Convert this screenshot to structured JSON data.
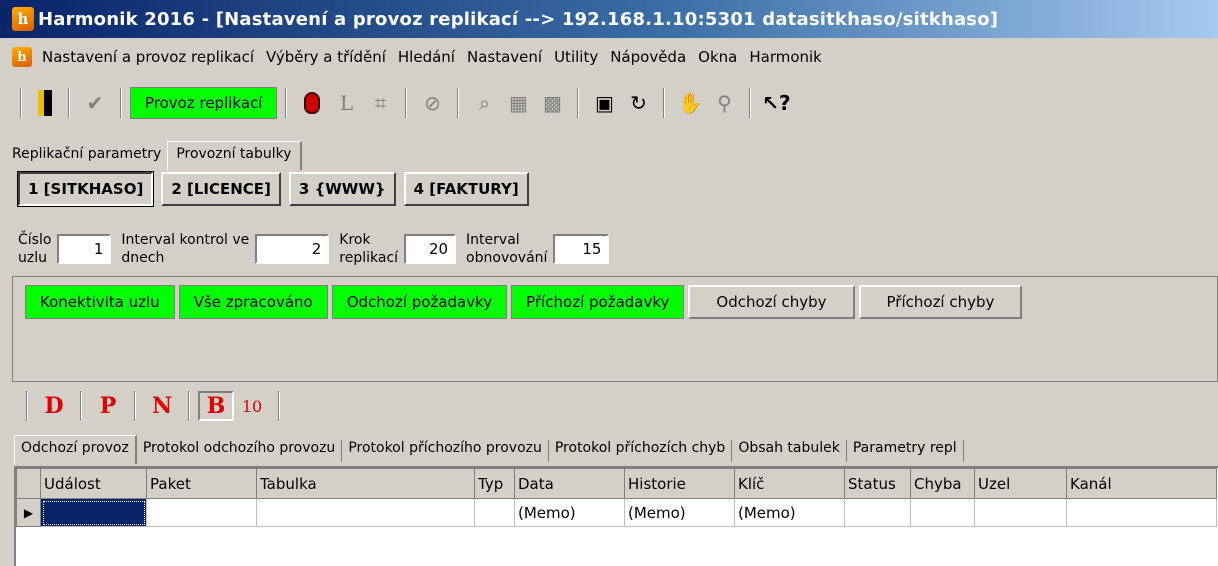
{
  "window": {
    "title": "Harmonik 2016 - [Nastavení a provoz replikací --> 192.168.1.10:5301 datasitkhaso/sitkhaso]",
    "icon": "harmonik-app-icon"
  },
  "menu": {
    "items": [
      "Nastavení a provoz replikací",
      "Výběry a třídění",
      "Hledání",
      "Nastavení",
      "Utility",
      "Nápověda",
      "Okna",
      "Harmonik"
    ]
  },
  "toolbar": {
    "mode_label": "Provoz replikací",
    "icons": [
      "exit-door-icon",
      "checkmark-icon",
      "mouse-icon",
      "l-icon",
      "pin-icon",
      "cancel-circle-icon",
      "magnifier-icon",
      "find-table-icon",
      "find-all-icon",
      "grid-icon",
      "refresh-icon",
      "hand-icon",
      "flashlight-icon",
      "help-pointer-icon"
    ],
    "accent": "#00ff00"
  },
  "param_tabs": [
    {
      "label": "Replikační parametry",
      "active": false
    },
    {
      "label": "Provozní tabulky",
      "active": true
    }
  ],
  "nodes": [
    {
      "label": "1 [SITKHASO]",
      "active": true
    },
    {
      "label": "2 [LICENCE]",
      "active": false
    },
    {
      "label": "3 {WWW}",
      "active": false
    },
    {
      "label": "4 [FAKTURY]",
      "active": false
    }
  ],
  "fields": {
    "node_number": {
      "label_line1": "Číslo",
      "label_line2": "uzlu",
      "value": "1"
    },
    "interval_days": {
      "label_line1": "Interval kontrol ve",
      "label_line2": "dnech",
      "value": "2"
    },
    "step": {
      "label_line1": "Krok",
      "label_line2": "replikací",
      "value": "20"
    },
    "refresh": {
      "label_line1": "Interval",
      "label_line2": "obnovování",
      "value": "15"
    }
  },
  "status_buttons": [
    {
      "label": "Konektivita uzlu",
      "green": true
    },
    {
      "label": "Vše zpracováno",
      "green": true
    },
    {
      "label": "Odchozí požadavky",
      "green": true
    },
    {
      "label": "Příchozí požadavky",
      "green": true
    },
    {
      "label": "Odchozí chyby",
      "green": false
    },
    {
      "label": "Příchozí chyby",
      "green": false
    }
  ],
  "filters": [
    {
      "label": "D",
      "pressed": false
    },
    {
      "label": "P",
      "pressed": false
    },
    {
      "label": "N",
      "pressed": false
    },
    {
      "label": "B",
      "pressed": true
    },
    {
      "label": "10",
      "pressed": false
    }
  ],
  "bottom_tabs": [
    {
      "label": "Odchozí provoz",
      "active": true
    },
    {
      "label": "Protokol odchozího provozu",
      "active": false
    },
    {
      "label": "Protokol příchozího provozu",
      "active": false
    },
    {
      "label": "Protokol příchozích chyb",
      "active": false
    },
    {
      "label": "Obsah tabulek",
      "active": false
    },
    {
      "label": "Parametry repl",
      "active": false
    }
  ],
  "grid": {
    "columns": [
      "Událost",
      "Paket",
      "Tabulka",
      "Typ",
      "Data",
      "Historie",
      "Klíč",
      "Status",
      "Chyba",
      "Uzel",
      "Kanál"
    ],
    "rows": [
      [
        "",
        "",
        "",
        "",
        "(Memo)",
        "(Memo)",
        "(Memo)",
        "",
        "",
        "",
        ""
      ]
    ]
  }
}
